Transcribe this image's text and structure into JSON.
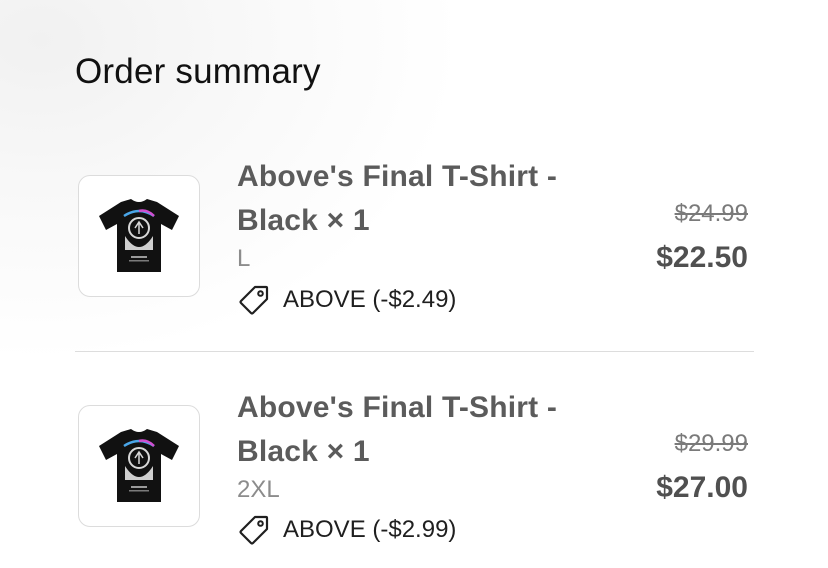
{
  "header": {
    "title": "Order summary"
  },
  "items": [
    {
      "title_line1": "Above's Final T-Shirt -",
      "title_line2": "Black × 1",
      "variant": "L",
      "discount_code": "ABOVE (-$2.49)",
      "original_price": "$24.99",
      "price": "$22.50",
      "thumbnail_icon": "tshirt-image"
    },
    {
      "title_line1": "Above's Final T-Shirt -",
      "title_line2": "Black × 1",
      "variant": "2XL",
      "discount_code": "ABOVE (-$2.99)",
      "original_price": "$29.99",
      "price": "$27.00",
      "thumbnail_icon": "tshirt-image"
    }
  ]
}
